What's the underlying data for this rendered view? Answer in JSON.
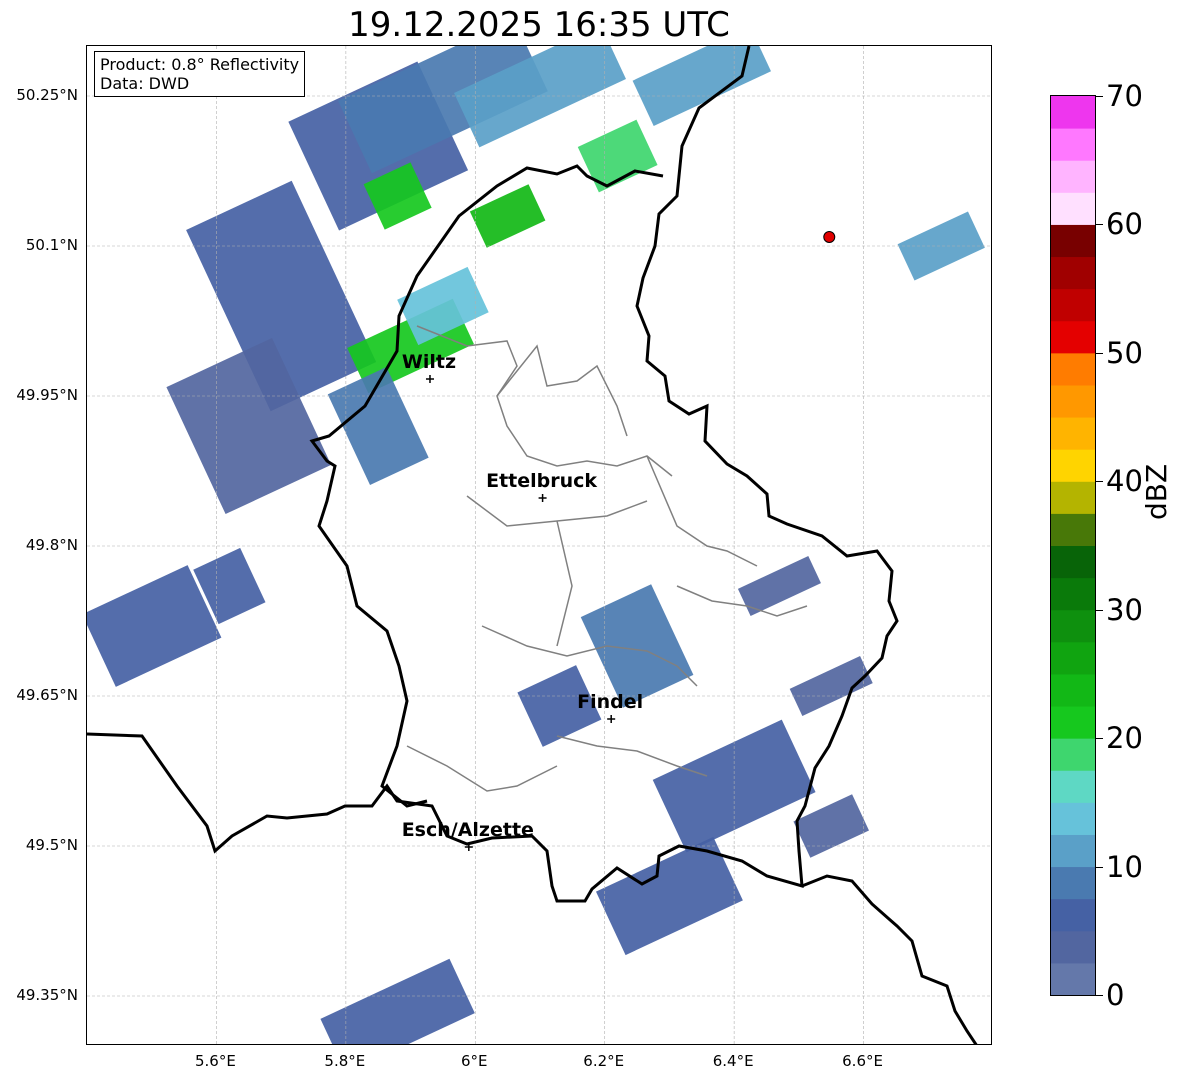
{
  "title": "19.12.2025 16:35 UTC",
  "info_box": {
    "product": "Product: 0.8° Reflectivity",
    "data": "Data: DWD"
  },
  "map": {
    "lon_range": [
      5.4,
      6.8
    ],
    "lat_range": [
      49.3,
      50.3
    ],
    "lat_ticks": [
      {
        "value": 50.25,
        "label": "50.25°N"
      },
      {
        "value": 50.1,
        "label": "50.1°N"
      },
      {
        "value": 49.95,
        "label": "49.95°N"
      },
      {
        "value": 49.8,
        "label": "49.8°N"
      },
      {
        "value": 49.65,
        "label": "49.65°N"
      },
      {
        "value": 49.5,
        "label": "49.5°N"
      },
      {
        "value": 49.35,
        "label": "49.35°N"
      }
    ],
    "lon_ticks": [
      {
        "value": 5.6,
        "label": "5.6°E"
      },
      {
        "value": 5.8,
        "label": "5.8°E"
      },
      {
        "value": 6.0,
        "label": "6°E"
      },
      {
        "value": 6.2,
        "label": "6.2°E"
      },
      {
        "value": 6.4,
        "label": "6.4°E"
      },
      {
        "value": 6.6,
        "label": "6.6°E"
      }
    ],
    "cities": [
      {
        "name": "Wiltz",
        "lon": 5.93,
        "lat": 49.967
      },
      {
        "name": "Ettelbruck",
        "lon": 6.104,
        "lat": 49.848
      },
      {
        "name": "Findel",
        "lon": 6.21,
        "lat": 49.627
      },
      {
        "name": "Esch/Alzette",
        "lon": 5.99,
        "lat": 49.499
      }
    ],
    "marker": {
      "lon": 6.547,
      "lat": 50.109,
      "color": "#e00000"
    },
    "border_color": "#000000",
    "canton_color": "#808080",
    "grid_color": "#b0b0b0"
  },
  "colorbar": {
    "label": "dBZ",
    "min": 0,
    "max": 70,
    "step": 2.5,
    "ticks": [
      0,
      10,
      20,
      30,
      40,
      50,
      60,
      70
    ],
    "colors": [
      "#6478aa",
      "#5266a0",
      "#4561a4",
      "#4a7ab0",
      "#5aa0c8",
      "#66c2da",
      "#5ed8c4",
      "#3ed66e",
      "#16c81e",
      "#12b816",
      "#10a410",
      "#0e900e",
      "#0a7a0a",
      "#086408",
      "#487808",
      "#b4b400",
      "#ffd400",
      "#ffb400",
      "#ff9800",
      "#ff7c00",
      "#e40000",
      "#c00000",
      "#a00000",
      "#780000",
      "#ffe0ff",
      "#ffb4ff",
      "#ff78ff",
      "#ee36ee"
    ]
  },
  "radar_cells": [
    {
      "lon": 5.85,
      "lat": 50.2,
      "dbz": 6,
      "w": 0.22,
      "h": 0.12
    },
    {
      "lon": 5.95,
      "lat": 50.25,
      "dbz": 8,
      "w": 0.3,
      "h": 0.08
    },
    {
      "lon": 6.1,
      "lat": 50.26,
      "dbz": 12,
      "w": 0.25,
      "h": 0.06
    },
    {
      "lon": 6.35,
      "lat": 50.27,
      "dbz": 10,
      "w": 0.2,
      "h": 0.05
    },
    {
      "lon": 5.88,
      "lat": 50.15,
      "dbz": 22,
      "w": 0.08,
      "h": 0.05
    },
    {
      "lon": 6.05,
      "lat": 50.13,
      "dbz": 24,
      "w": 0.1,
      "h": 0.04
    },
    {
      "lon": 6.22,
      "lat": 50.19,
      "dbz": 18,
      "w": 0.1,
      "h": 0.05
    },
    {
      "lon": 5.7,
      "lat": 50.05,
      "dbz": 5,
      "w": 0.18,
      "h": 0.2
    },
    {
      "lon": 5.65,
      "lat": 49.92,
      "dbz": 4,
      "w": 0.18,
      "h": 0.14
    },
    {
      "lon": 5.9,
      "lat": 50.0,
      "dbz": 22,
      "w": 0.18,
      "h": 0.05
    },
    {
      "lon": 5.95,
      "lat": 50.04,
      "dbz": 14,
      "w": 0.12,
      "h": 0.05
    },
    {
      "lon": 5.85,
      "lat": 49.92,
      "dbz": 8,
      "w": 0.1,
      "h": 0.1
    },
    {
      "lon": 5.5,
      "lat": 49.72,
      "dbz": 6,
      "w": 0.18,
      "h": 0.08
    },
    {
      "lon": 5.62,
      "lat": 49.76,
      "dbz": 5,
      "w": 0.08,
      "h": 0.06
    },
    {
      "lon": 6.72,
      "lat": 50.1,
      "dbz": 10,
      "w": 0.12,
      "h": 0.04
    },
    {
      "lon": 6.25,
      "lat": 49.7,
      "dbz": 8,
      "w": 0.12,
      "h": 0.1
    },
    {
      "lon": 6.13,
      "lat": 49.64,
      "dbz": 6,
      "w": 0.1,
      "h": 0.06
    },
    {
      "lon": 6.4,
      "lat": 49.56,
      "dbz": 6,
      "w": 0.22,
      "h": 0.08
    },
    {
      "lon": 6.3,
      "lat": 49.45,
      "dbz": 5,
      "w": 0.2,
      "h": 0.07
    },
    {
      "lon": 6.55,
      "lat": 49.66,
      "dbz": 4,
      "w": 0.12,
      "h": 0.03
    },
    {
      "lon": 6.55,
      "lat": 49.52,
      "dbz": 4,
      "w": 0.1,
      "h": 0.04
    },
    {
      "lon": 5.88,
      "lat": 49.33,
      "dbz": 6,
      "w": 0.22,
      "h": 0.06
    },
    {
      "lon": 6.47,
      "lat": 49.76,
      "dbz": 3,
      "w": 0.12,
      "h": 0.03
    }
  ]
}
